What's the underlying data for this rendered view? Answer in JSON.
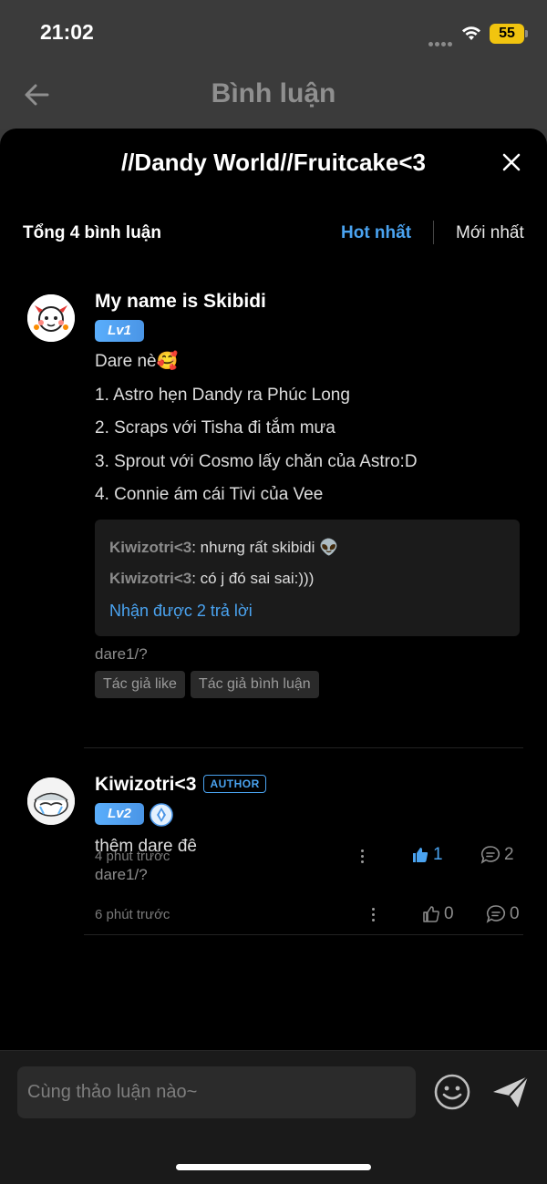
{
  "status_bar": {
    "time": "21:02",
    "battery": "55"
  },
  "header": {
    "title": "Bình luận"
  },
  "sheet": {
    "title": "//Dandy World//Fruitcake<3",
    "comment_count": "Tổng 4 bình luận",
    "sort_hot": "Hot nhất",
    "sort_new": "Mới nhất"
  },
  "comments": [
    {
      "name": "My name is Skibidi",
      "level": "Lv1",
      "lines": [
        "Dare nè🥰",
        "1. Astro hẹn Dandy ra Phúc Long",
        "2. Scraps với Tisha đi tắm mưa",
        "3. Sprout với Cosmo lấy chăn của Astro:D",
        "4. Connie ám cái Tivi của Vee"
      ],
      "replies": [
        {
          "user": "Kiwizotri<3",
          "text": ": nhưng rất skibidi 👽"
        },
        {
          "user": "Kiwizotri<3",
          "text": ": có j đó sai sai:)))"
        }
      ],
      "more_replies": "Nhận được 2 trả lời",
      "tag_text": "dare1/?",
      "chips": [
        "Tác giả like",
        "Tác giả bình luận"
      ],
      "time": "4 phút trước",
      "likes": "1",
      "replies_count": "2"
    },
    {
      "name": "Kiwizotri<3",
      "author_badge": "AUTHOR",
      "level": "Lv2",
      "lines": [
        "thêm dare đê"
      ],
      "tag_text": "dare1/?",
      "time": "6 phút trước",
      "likes": "0",
      "replies_count": "0"
    }
  ],
  "footer": {
    "input_placeholder": "Cùng thảo luận nào~"
  },
  "colors": {
    "accent": "#4aa3f0",
    "background": "#000000",
    "badge": "#f1c40f"
  }
}
